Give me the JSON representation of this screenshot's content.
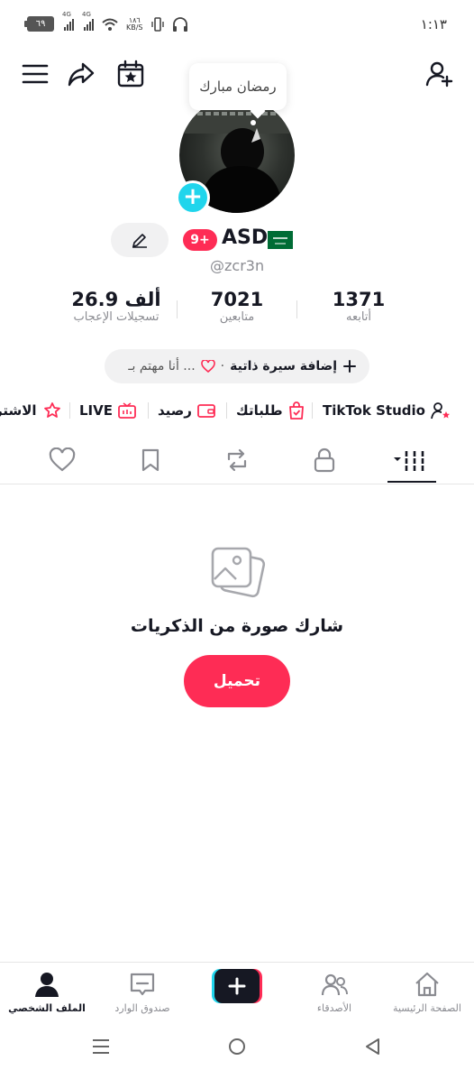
{
  "status_bar": {
    "battery": "٦٩",
    "signal_1_label": "4G",
    "signal_2_label": "4G",
    "net_speed_value": "١٨٦",
    "net_speed_unit": "KB/S",
    "time": "١:١٣"
  },
  "tooltip": {
    "text": "رمضان مبارك"
  },
  "profile": {
    "username": "ASD",
    "handle": "@zcr3n",
    "notification_badge": "9+",
    "stats": [
      {
        "value": "1371",
        "label": "أتابعه"
      },
      {
        "value": "7021",
        "label": "متابعين"
      },
      {
        "value": "26.9 ألف",
        "label": "تسجيلات الإعجاب"
      }
    ],
    "bio": {
      "add_bio": "إضافة سيرة ذاتية",
      "separator": "·",
      "interested": "أنا مهتم بـ ..."
    }
  },
  "shortcuts": [
    {
      "label": "TikTok Studio",
      "icon": "person-star-icon"
    },
    {
      "label": "طلباتك",
      "icon": "bag-check-icon"
    },
    {
      "label": "رصيد",
      "icon": "wallet-icon"
    },
    {
      "label": "LIVE",
      "icon": "tv-live-icon"
    },
    {
      "label": "الاشتر",
      "icon": "subscription-star-icon"
    }
  ],
  "tabs": [
    {
      "name": "videos-grid",
      "icon": "grid-icon",
      "active": true
    },
    {
      "name": "private",
      "icon": "lock-icon"
    },
    {
      "name": "reposts",
      "icon": "repost-icon"
    },
    {
      "name": "favorites",
      "icon": "bookmark-icon"
    },
    {
      "name": "liked",
      "icon": "heart-icon"
    }
  ],
  "empty_state": {
    "title": "شارك صورة من الذكريات",
    "button": "تحميل"
  },
  "bottom_nav": [
    {
      "label": "الصفحة الرئيسية",
      "icon": "home-icon"
    },
    {
      "label": "الأصدقاء",
      "icon": "friends-icon"
    },
    {
      "label": "",
      "icon": "create-plus-icon"
    },
    {
      "label": "صندوق الوارد",
      "icon": "inbox-icon"
    },
    {
      "label": "الملف الشخصي",
      "icon": "profile-icon",
      "active": true
    }
  ],
  "colors": {
    "accent": "#fe2c55",
    "cyan": "#20d5ec",
    "text": "#161823",
    "muted": "#8a8b91"
  }
}
